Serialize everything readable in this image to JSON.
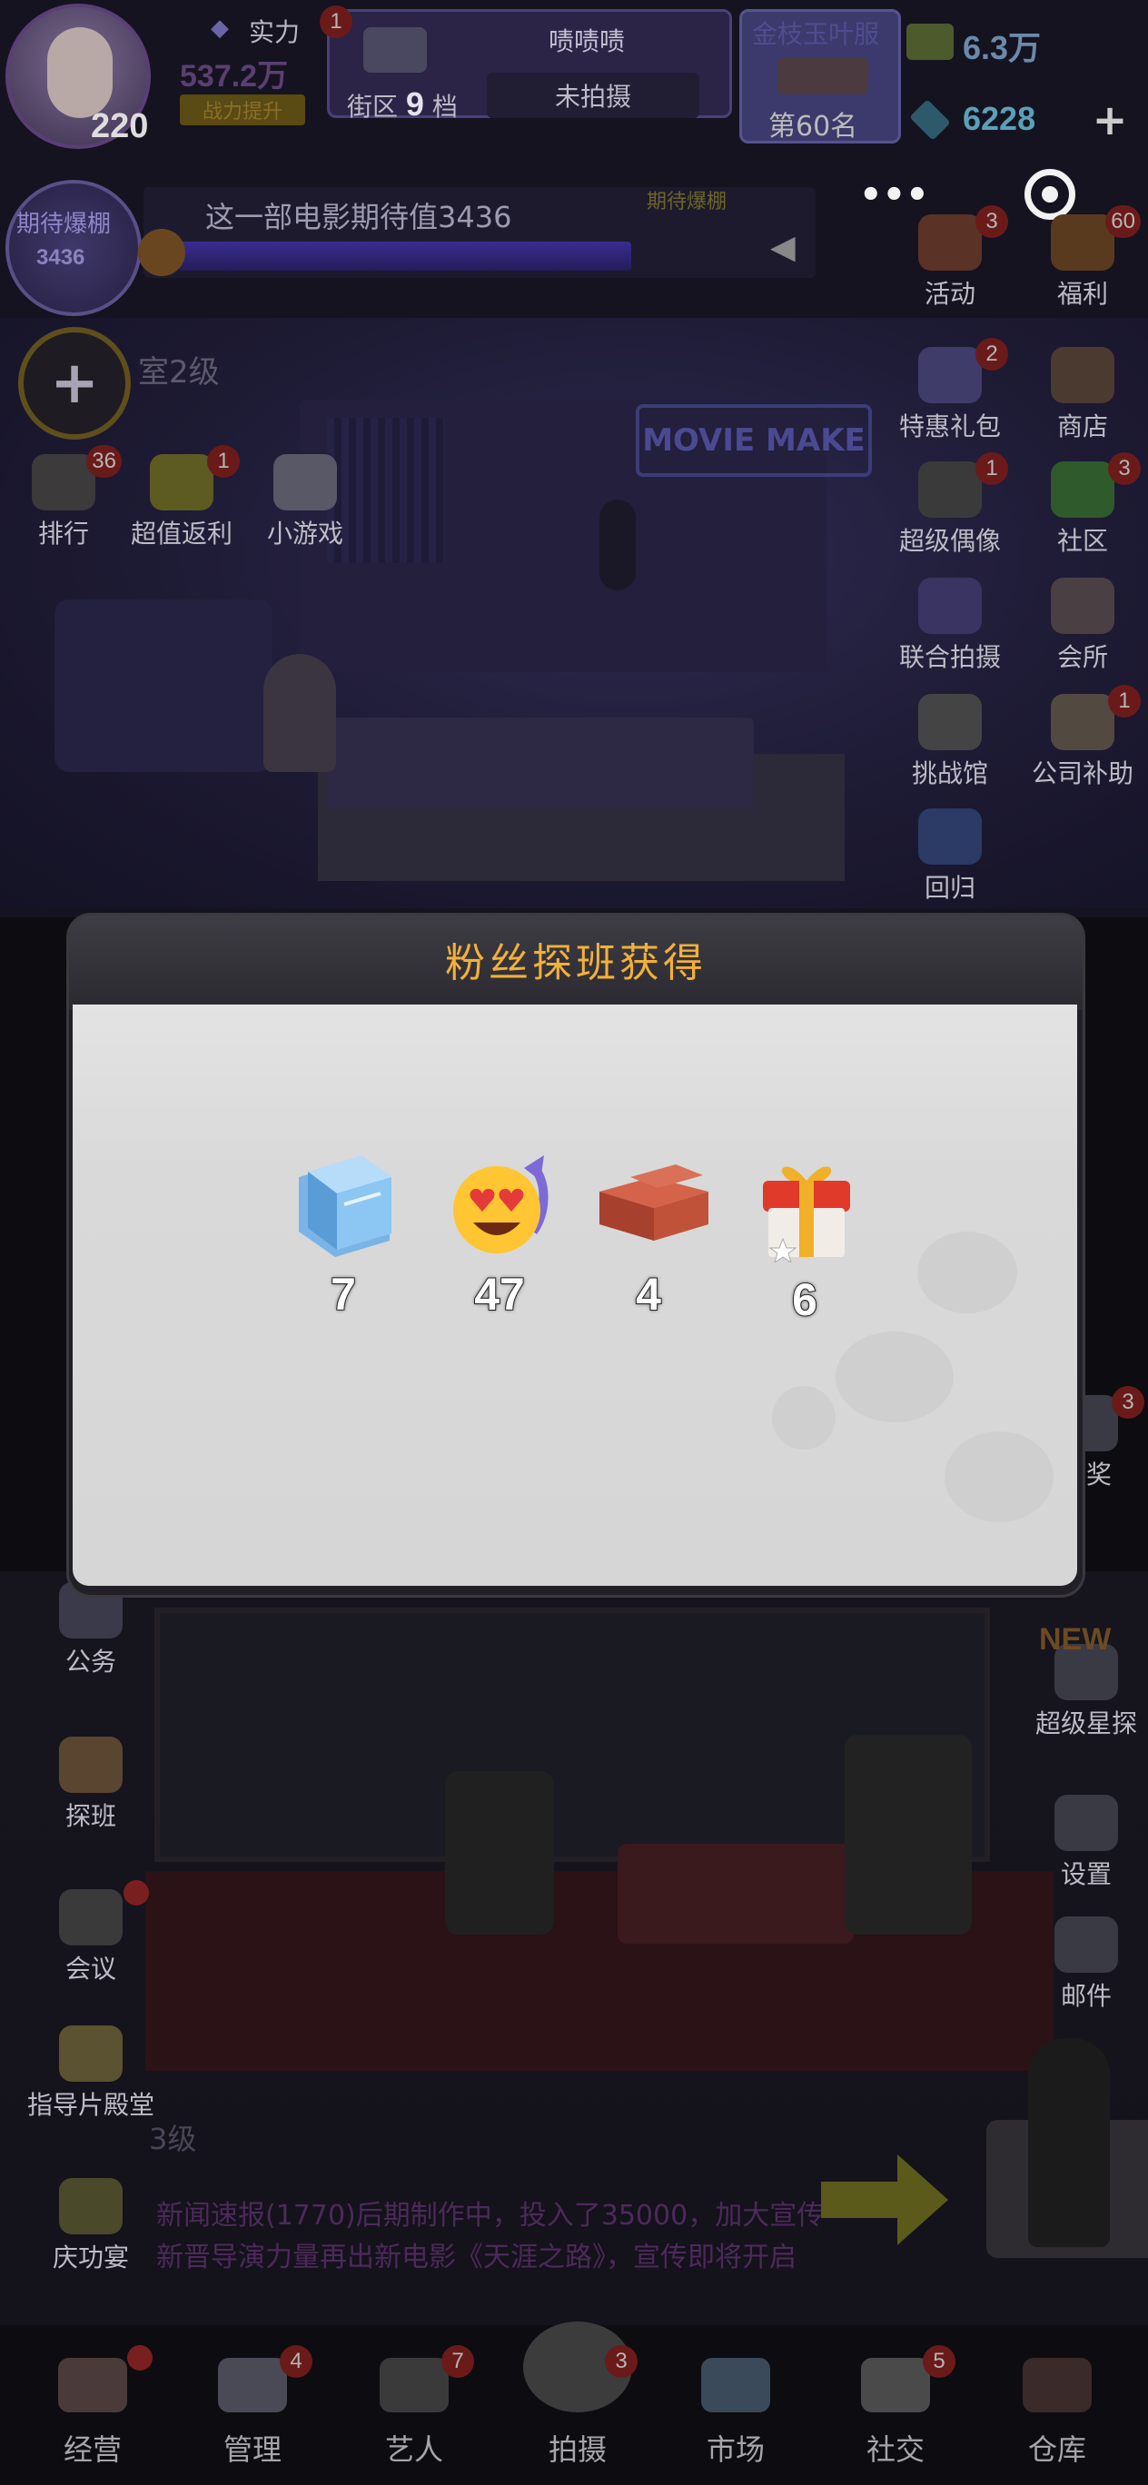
{
  "hud": {
    "level": "220",
    "power_label": "实力",
    "power_value": "537.2万",
    "power_sub": "战力提升",
    "district_badge": "1",
    "district_prefix": "街区",
    "district_num": "9",
    "district_suffix": "档",
    "film_name": "啧啧啧",
    "film_status": "未拍摄",
    "rank_title": "金枝玉叶服",
    "rank_text": "第60名",
    "cash": "6.3万",
    "gems": "6228",
    "plus": "+"
  },
  "anticipation": {
    "circle_label": "期待爆棚",
    "circle_value": "3436",
    "bar_text": "这一部电影期待值3436",
    "marker_text": "期待爆棚",
    "fill_fraction": 0.78
  },
  "room": {
    "add": "+",
    "label": "室2级",
    "sign": "MOVIE MAKE"
  },
  "left_top_menu": [
    {
      "label": "排行",
      "badge": "36",
      "color": "#3c3a3a"
    },
    {
      "label": "超值返利",
      "badge": "1",
      "color": "#5d5a22"
    },
    {
      "label": "小游戏",
      "badge": "",
      "color": "#585866"
    }
  ],
  "right_menu": [
    {
      "label": "活动",
      "badge": "3",
      "color": "#5a3226"
    },
    {
      "label": "福利",
      "badge": "60",
      "color": "#5a3a1e"
    },
    {
      "label": "特惠礼包",
      "badge": "2",
      "color": "#3f3c6a"
    },
    {
      "label": "商店",
      "badge": "",
      "color": "#4a3a30"
    },
    {
      "label": "超级偶像",
      "badge": "1",
      "color": "#3a3a3a"
    },
    {
      "label": "社区",
      "badge": "3",
      "color": "#2f5a2c"
    },
    {
      "label": "联合拍摄",
      "badge": "",
      "color": "#3a3462"
    },
    {
      "label": "会所",
      "badge": "",
      "color": "#4a4044"
    },
    {
      "label": "挑战馆",
      "badge": "",
      "color": "#444"
    },
    {
      "label": "公司补助",
      "badge": "1",
      "color": "#524a40"
    },
    {
      "label": "回归",
      "badge": "",
      "color": "#2c3a66"
    }
  ],
  "dialog": {
    "title": "粉丝探班获得",
    "rewards": [
      {
        "icon": "glass-panel-icon",
        "count": "7"
      },
      {
        "icon": "heart-eyes-emoji-icon",
        "count": "47"
      },
      {
        "icon": "bricks-icon",
        "count": "4"
      },
      {
        "icon": "gift-box-icon",
        "count": "6"
      }
    ]
  },
  "lower_left_menu": [
    {
      "label": "公务",
      "badge": "",
      "color": "#3a3a4a"
    },
    {
      "label": "探班",
      "badge": "",
      "color": "#5a4630"
    },
    {
      "label": "会议",
      "badge": "•",
      "color": "#3a3a3a"
    },
    {
      "label": "指导片殿堂",
      "badge": "",
      "color": "#5a5230"
    },
    {
      "label": "庆功宴",
      "badge": "",
      "color": "#4a4a2a"
    }
  ],
  "lower_right_menu": [
    {
      "label": "驼奖",
      "badge": "3"
    },
    {
      "label": "超级星探",
      "badge": "",
      "tag": "NEW"
    },
    {
      "label": "设置",
      "badge": ""
    },
    {
      "label": "邮件",
      "badge": ""
    }
  ],
  "news": {
    "level": "3级",
    "line1": "新闻速报(1770)后期制作中，投入了35000，加大宣传",
    "line2": "新晋导演力量再出新电影《天涯之路》，宣传即将开启"
  },
  "bottom_nav": [
    {
      "label": "经营",
      "badge": "•",
      "color": "#4a3a3a"
    },
    {
      "label": "管理",
      "badge": "4",
      "color": "#4a4a56"
    },
    {
      "label": "艺人",
      "badge": "7",
      "color": "#3a3a3a"
    },
    {
      "label": "拍摄",
      "badge": "3",
      "color": "#3c3c3c"
    },
    {
      "label": "市场",
      "badge": "",
      "color": "#3a4a5a"
    },
    {
      "label": "社交",
      "badge": "5",
      "color": "#4a4a4a"
    },
    {
      "label": "仓库",
      "badge": "",
      "color": "#3a2a2a"
    }
  ]
}
